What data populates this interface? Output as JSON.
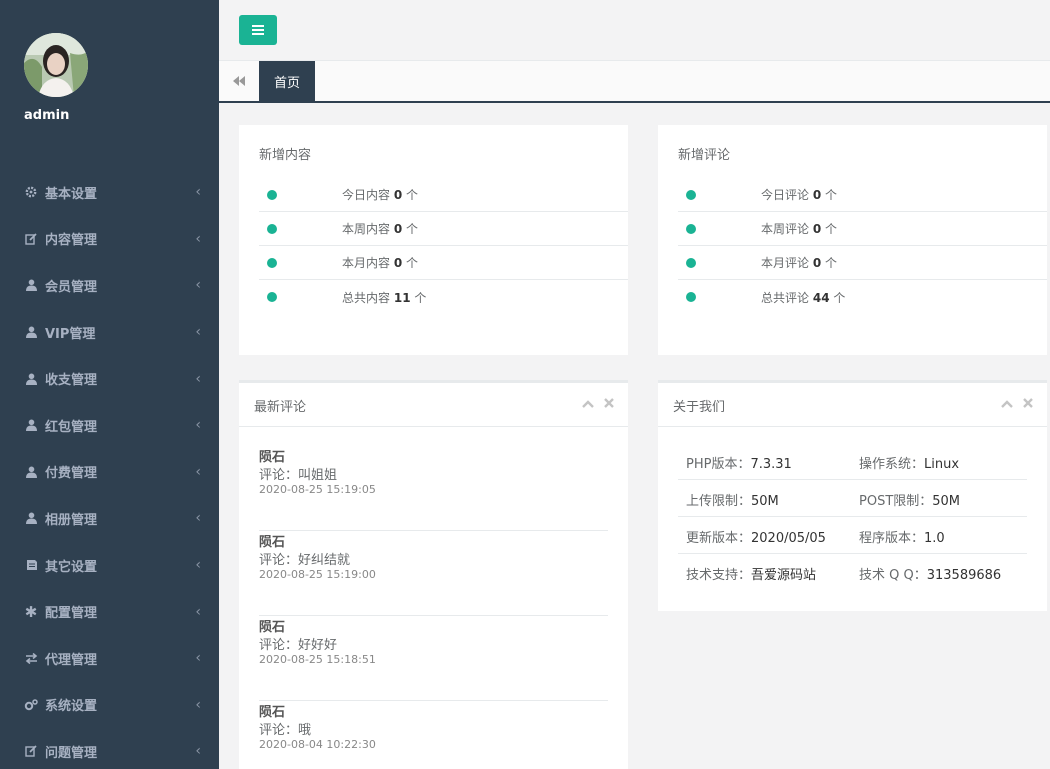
{
  "user": {
    "name": "admin"
  },
  "nav": [
    {
      "label": "基本设置",
      "icon": "gear-icon"
    },
    {
      "label": "内容管理",
      "icon": "edit-icon"
    },
    {
      "label": "会员管理",
      "icon": "user-icon"
    },
    {
      "label": "VIP管理",
      "icon": "user-icon"
    },
    {
      "label": "收支管理",
      "icon": "user-icon"
    },
    {
      "label": "红包管理",
      "icon": "user-icon"
    },
    {
      "label": "付费管理",
      "icon": "user-icon"
    },
    {
      "label": "相册管理",
      "icon": "user-icon"
    },
    {
      "label": "其它设置",
      "icon": "book-icon"
    },
    {
      "label": "配置管理",
      "icon": "asterisk-icon"
    },
    {
      "label": "代理管理",
      "icon": "exchange-icon"
    },
    {
      "label": "系统设置",
      "icon": "gears-icon"
    },
    {
      "label": "问题管理",
      "icon": "edit-icon"
    }
  ],
  "tabs": {
    "home": "首页"
  },
  "new_content": {
    "title": "新增内容",
    "rows": [
      {
        "label": "今日内容",
        "value": "0",
        "unit": "个"
      },
      {
        "label": "本周内容",
        "value": "0",
        "unit": "个"
      },
      {
        "label": "本月内容",
        "value": "0",
        "unit": "个"
      },
      {
        "label": "总共内容",
        "value": "11",
        "unit": "个"
      }
    ]
  },
  "new_comments": {
    "title": "新增评论",
    "rows": [
      {
        "label": "今日评论",
        "value": "0",
        "unit": "个"
      },
      {
        "label": "本周评论",
        "value": "0",
        "unit": "个"
      },
      {
        "label": "本月评论",
        "value": "0",
        "unit": "个"
      },
      {
        "label": "总共评论",
        "value": "44",
        "unit": "个"
      }
    ]
  },
  "latest_comments": {
    "title": "最新评论",
    "items": [
      {
        "author": "陨石",
        "text": "评论：叫姐姐",
        "time": "2020-08-25 15:19:05"
      },
      {
        "author": "陨石",
        "text": "评论：好纠结就",
        "time": "2020-08-25 15:19:00"
      },
      {
        "author": "陨石",
        "text": "评论：好好好",
        "time": "2020-08-25 15:18:51"
      },
      {
        "author": "陨石",
        "text": "评论：哦",
        "time": "2020-08-04 10:22:30"
      }
    ]
  },
  "about": {
    "title": "关于我们",
    "rows": [
      [
        {
          "label": "PHP版本：",
          "value": "7.3.31"
        },
        {
          "label": "操作系统：",
          "value": "Linux"
        }
      ],
      [
        {
          "label": "上传限制：",
          "value": "50M"
        },
        {
          "label": "POST限制：",
          "value": "50M"
        }
      ],
      [
        {
          "label": "更新版本：",
          "value": "2020/05/05"
        },
        {
          "label": "程序版本：",
          "value": "1.0"
        }
      ],
      [
        {
          "label": "技术支持：",
          "value": "吾爱源码站"
        },
        {
          "label": "技术 Q Q：",
          "value": "313589686"
        }
      ]
    ]
  },
  "colors": {
    "sidebar": "#2f4050",
    "accent": "#1ab394"
  }
}
